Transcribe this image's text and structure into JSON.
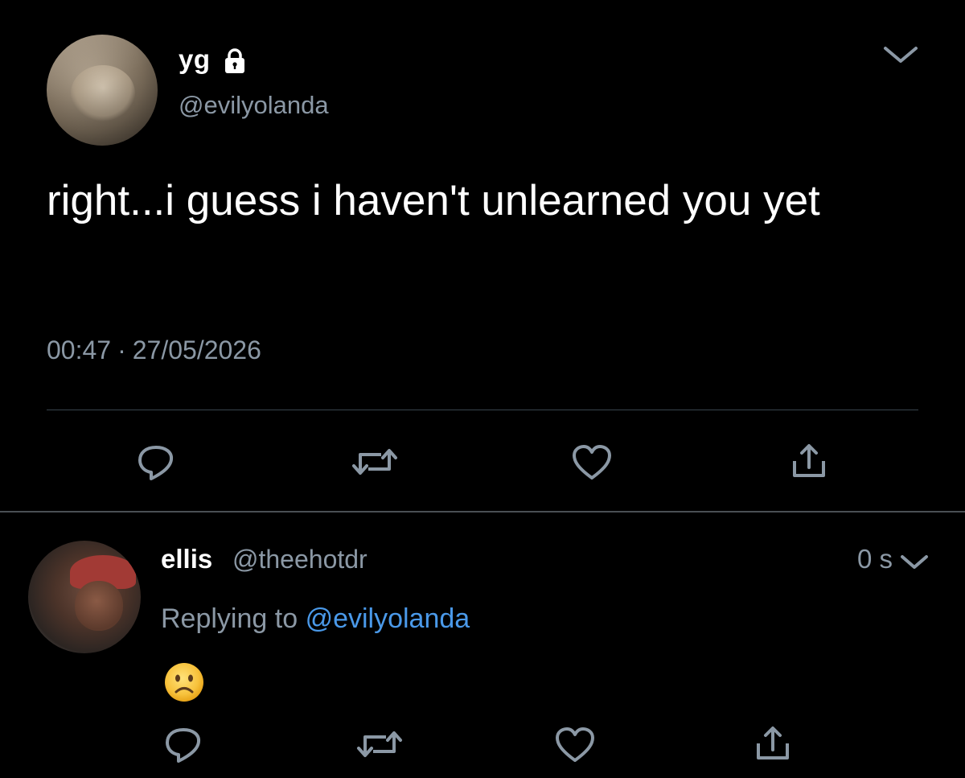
{
  "main_tweet": {
    "display_name": "yg",
    "handle": "@evilyolanda",
    "text": "right...i guess i haven't unlearned you yet",
    "time": "00:47",
    "separator": "·",
    "date": "27/05/2026",
    "protected_icon": "lock-icon",
    "menu_icon": "chevron-down-icon"
  },
  "reply_tweet": {
    "display_name": "ellis",
    "handle": "@theehotdr",
    "age": "0 s",
    "replying_prefix": "Replying to",
    "replying_to": "@evilyolanda",
    "emoji": "☹️",
    "menu_icon": "chevron-down-icon"
  },
  "actions": [
    "reply-icon",
    "retweet-icon",
    "like-icon",
    "share-icon"
  ],
  "colors": {
    "background": "#000000",
    "text": "#ffffff",
    "secondary": "#8b98a5",
    "link": "#4a99e9",
    "divider": "#38444d"
  }
}
